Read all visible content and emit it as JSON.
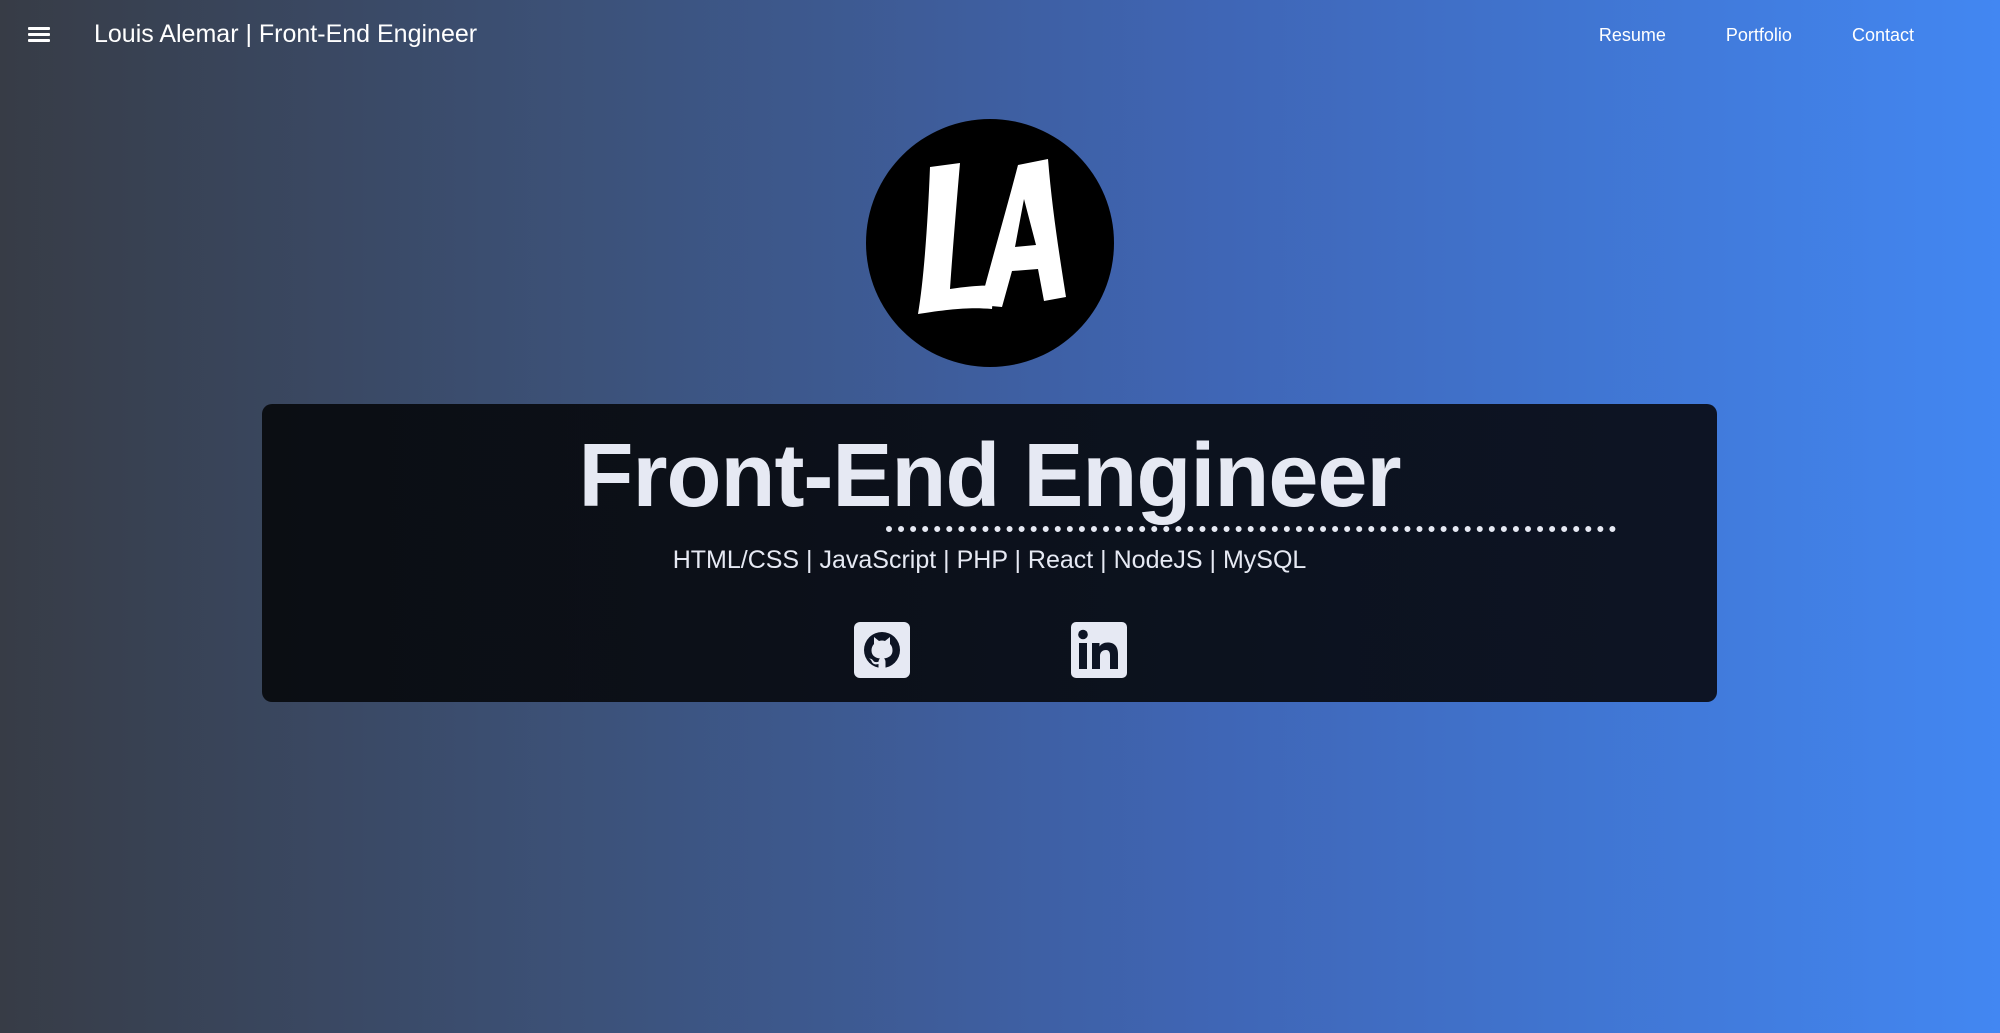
{
  "header": {
    "site_title": "Louis Alemar | Front-End Engineer",
    "nav": [
      {
        "label": "Resume"
      },
      {
        "label": "Portfolio"
      },
      {
        "label": "Contact"
      }
    ]
  },
  "logo": {
    "text": "LA"
  },
  "hero": {
    "title": "Front-End Engineer",
    "skills": "HTML/CSS | JavaScript | PHP | React | NodeJS | MySQL",
    "social": [
      {
        "icon": "github-icon"
      },
      {
        "icon": "linkedin-icon"
      }
    ]
  },
  "colors": {
    "background_start": "#373c46",
    "background_end": "#4287f2",
    "card": "#0d1424",
    "text_light": "#e6e9f3"
  }
}
